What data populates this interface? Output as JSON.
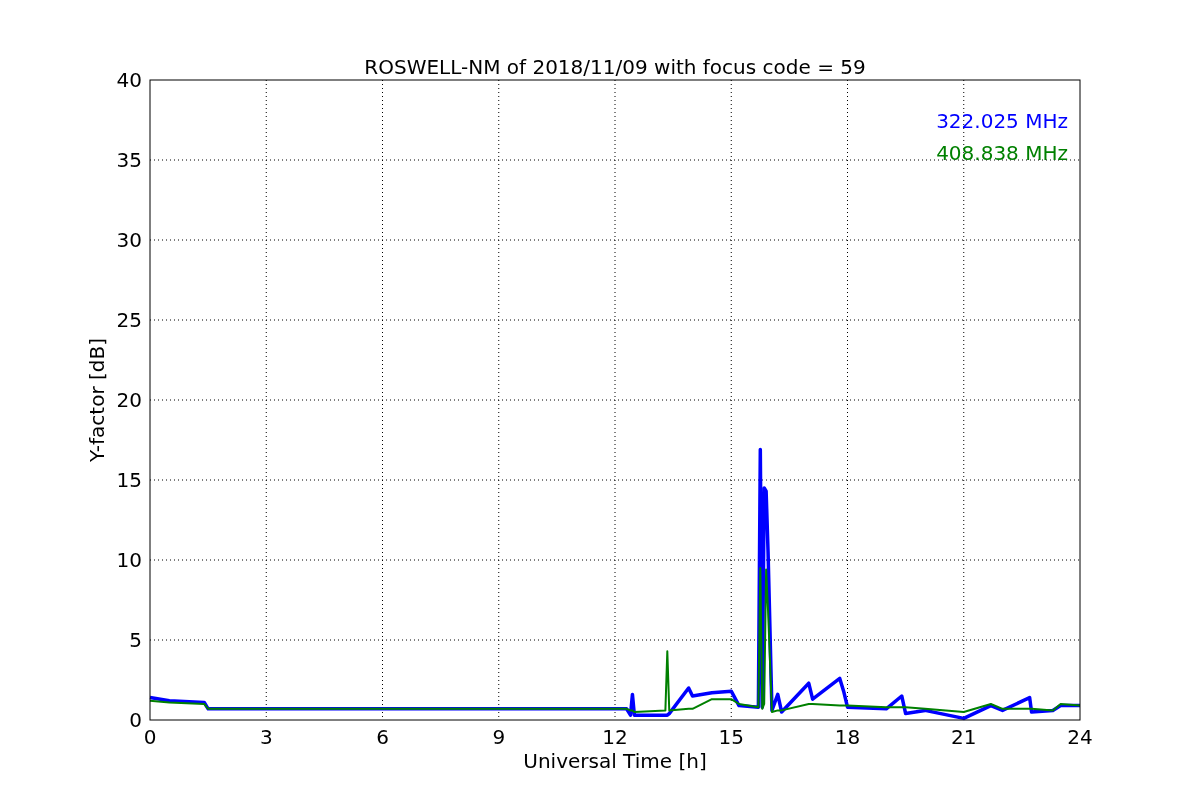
{
  "figure": {
    "chart_data": {
      "type": "line",
      "title": "ROSWELL-NM of 2018/11/09 with focus code = 59",
      "xlabel": "Universal Time [h]",
      "ylabel": "Y-factor [dB]",
      "grid": true,
      "xlim": [
        0,
        24
      ],
      "ylim": [
        0,
        40
      ],
      "xticks": [
        0,
        3,
        6,
        9,
        12,
        15,
        18,
        21,
        24
      ],
      "yticks": [
        0,
        5,
        10,
        15,
        20,
        25,
        30,
        35,
        40
      ],
      "x": [
        0,
        0.5,
        1.4,
        1.5,
        12.3,
        12.4,
        12.45,
        12.5,
        13.3,
        13.35,
        13.4,
        13.9,
        14.0,
        14.5,
        15.0,
        15.2,
        15.7,
        15.75,
        15.8,
        15.85,
        15.9,
        15.95,
        16.05,
        16.2,
        16.3,
        17.0,
        17.1,
        17.8,
        17.9,
        18.0,
        19.0,
        19.4,
        19.5,
        20.0,
        21.0,
        21.7,
        22.0,
        22.7,
        22.75,
        23.3,
        23.5,
        24
      ],
      "series": [
        {
          "name": "322.025 MHz",
          "color": "#0000ff",
          "values": [
            1.4,
            1.2,
            1.1,
            0.7,
            0.7,
            0.3,
            1.6,
            0.3,
            0.3,
            0.3,
            0.4,
            2.0,
            1.5,
            1.7,
            1.8,
            0.9,
            0.8,
            16.9,
            0.8,
            14.5,
            14.3,
            10.5,
            0.6,
            1.6,
            0.5,
            2.3,
            1.3,
            2.6,
            1.8,
            0.8,
            0.7,
            1.5,
            0.4,
            0.6,
            0.1,
            0.9,
            0.6,
            1.4,
            0.5,
            0.6,
            0.9,
            0.9
          ]
        },
        {
          "name": "408.838 MHz",
          "color": "#008000",
          "values": [
            1.2,
            1.1,
            1.0,
            0.7,
            0.7,
            0.6,
            0.6,
            0.5,
            0.6,
            4.3,
            0.6,
            0.7,
            0.7,
            1.3,
            1.3,
            1.0,
            0.8,
            9.5,
            0.7,
            1.0,
            9.4,
            6.8,
            0.5,
            0.6,
            0.6,
            1.0,
            1.0,
            0.9,
            0.9,
            0.9,
            0.8,
            0.8,
            0.8,
            0.7,
            0.5,
            1.0,
            0.7,
            0.7,
            0.7,
            0.6,
            1.0,
            0.9
          ]
        }
      ]
    }
  }
}
